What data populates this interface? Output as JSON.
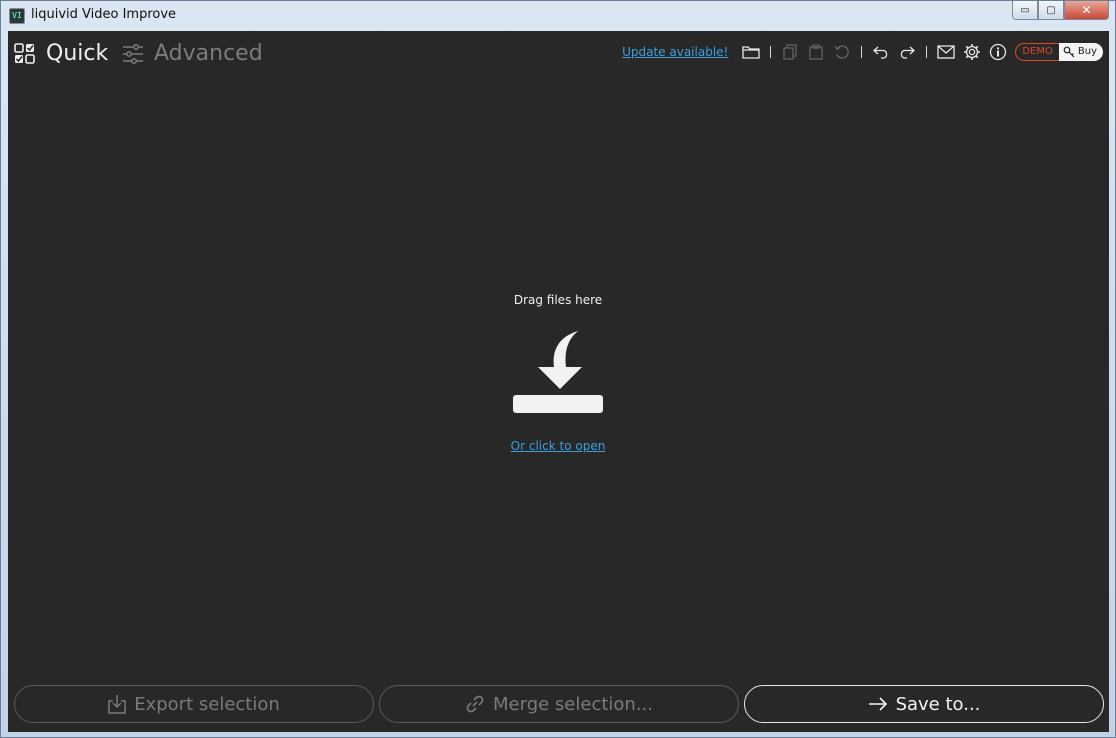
{
  "window": {
    "app_icon_text": "VI",
    "title": "liquivid Video Improve",
    "minimize": "▭",
    "maximize": "▢",
    "close": "✕"
  },
  "modes": {
    "quick": "Quick",
    "advanced": "Advanced"
  },
  "toolbar": {
    "update_link": "Update available!",
    "icons": [
      "folder-open-icon",
      "copy-icon",
      "paste-icon",
      "reset-icon",
      "undo-icon",
      "redo-icon",
      "mail-icon",
      "gear-icon",
      "info-icon"
    ],
    "demo_label": "DEMO",
    "buy_label": "Buy"
  },
  "drop_zone": {
    "title": "Drag files here",
    "open_link": "Or click to open"
  },
  "bottom": {
    "export": "Export selection",
    "merge": "Merge selection...",
    "save": "Save to..."
  },
  "colors": {
    "background": "#282828",
    "link": "#3aa0dc",
    "demo": "#d94a2a",
    "disabled": "#7a7a7a"
  }
}
